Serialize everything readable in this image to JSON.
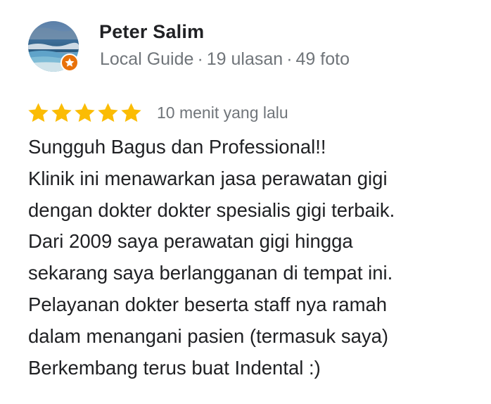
{
  "reviewer": {
    "name": "Peter Salim",
    "badge": "Local Guide",
    "reviews_count": "19 ulasan",
    "photos_count": "49 foto",
    "separator": "·",
    "avatar_icon": "beach-photo-avatar",
    "badge_icon": "star-badge-icon",
    "badge_color": "#e8710a"
  },
  "rating": {
    "stars": 5,
    "max_stars": 5,
    "star_color": "#fbbc04",
    "timestamp": "10 menit yang lalu"
  },
  "review": {
    "lines": [
      "Sungguh Bagus dan Professional!!",
      "Klinik ini menawarkan jasa perawatan gigi",
      "dengan dokter dokter spesialis gigi terbaik.",
      "Dari 2009 saya perawatan gigi hingga",
      "sekarang saya berlangganan di tempat ini.",
      "Pelayanan dokter beserta staff nya ramah",
      "dalam menangani pasien (termasuk saya)",
      "Berkembang terus buat Indental :)"
    ]
  }
}
